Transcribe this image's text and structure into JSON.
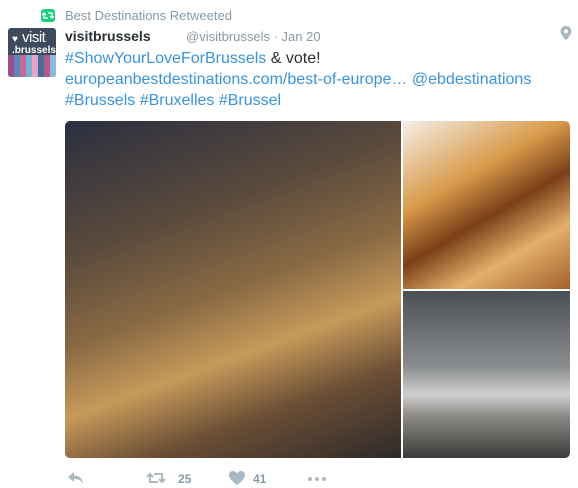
{
  "retweet_context": "Best Destinations Retweeted",
  "author": {
    "name": "visitbrussels",
    "handle_and_time": "@visitbrussels · Jan 20",
    "avatar": {
      "text_top": "visit",
      "text_bottom": ".brussels",
      "heart": "♥"
    }
  },
  "tweet": {
    "hashtag_main": "#ShowYourLoveForBrussels",
    "text_vote": " & vote!",
    "link_url": "europeanbestdestinations.com/best-of-europe…",
    "mention": "@ebdestinations",
    "tags": "#Brussels #Bruxelles #Brussel"
  },
  "actions": {
    "retweet_count": "25",
    "like_count": "41"
  },
  "colors": {
    "link": "#3b94d9",
    "meta": "#8899a6",
    "retweet_green": "#19cf86",
    "text": "#292f33"
  },
  "icons": [
    "retweet-icon",
    "pin-icon",
    "reply-icon",
    "retweet-icon",
    "heart-icon",
    "more-icon"
  ]
}
